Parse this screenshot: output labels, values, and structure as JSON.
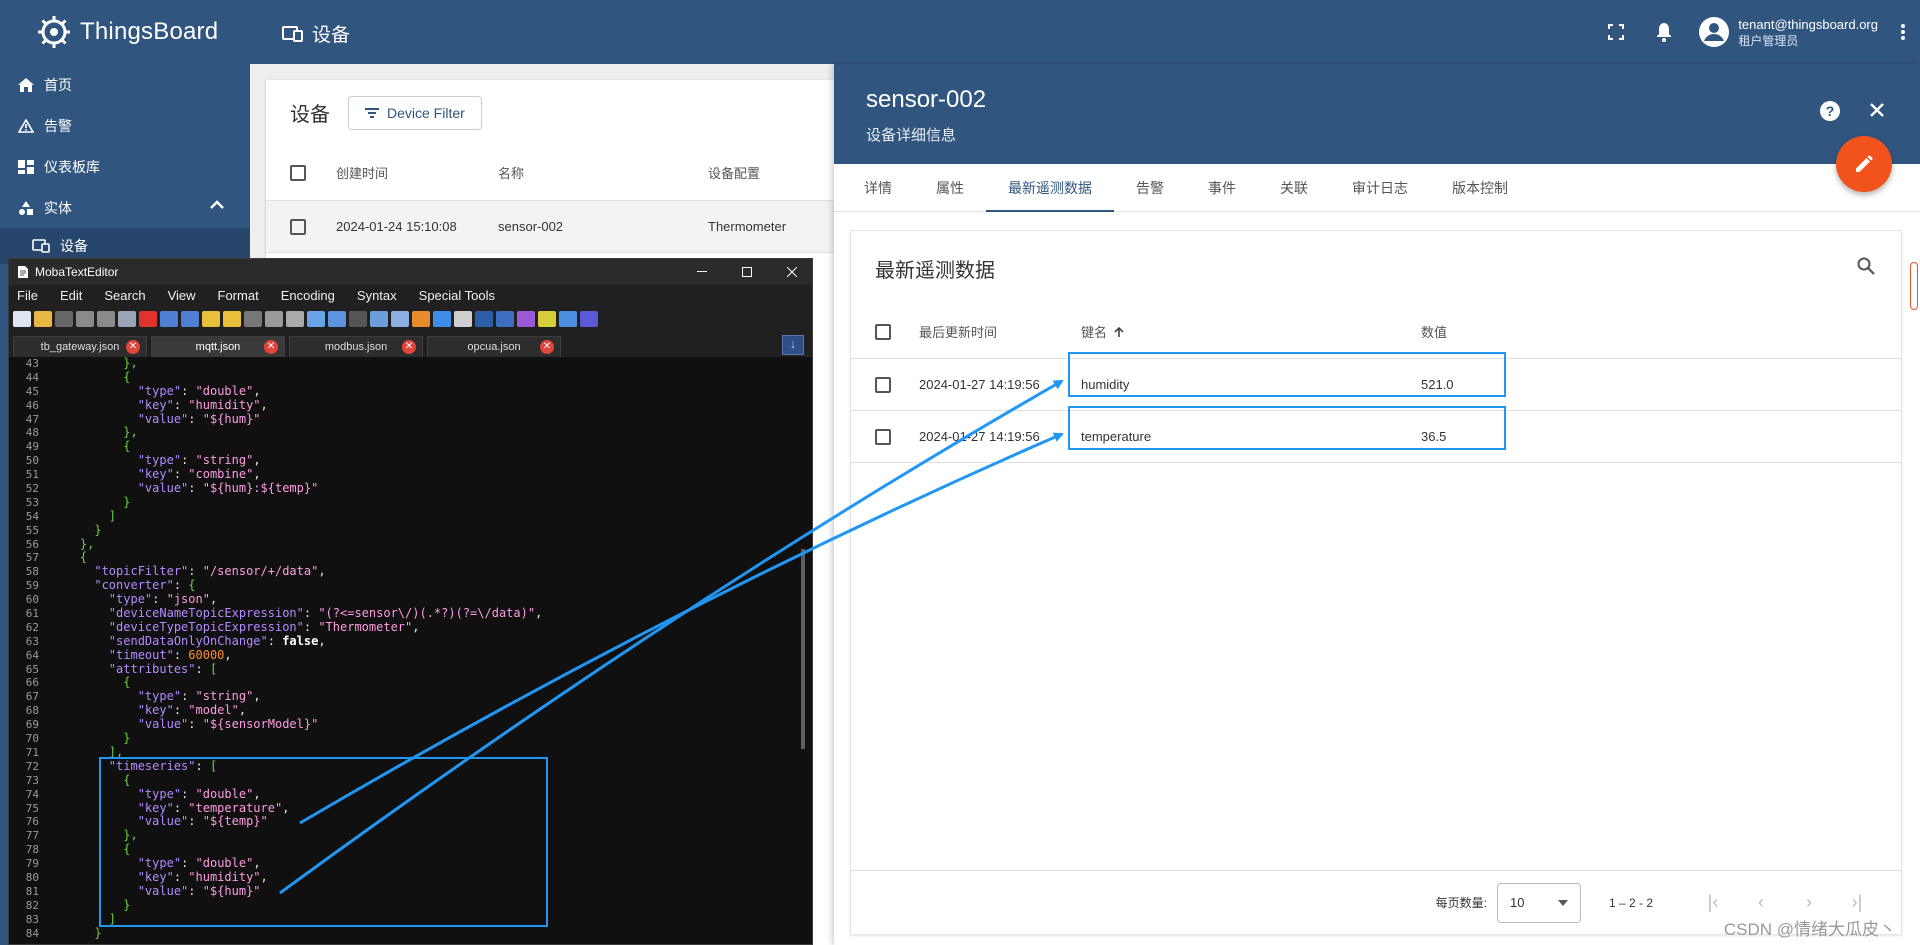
{
  "app": {
    "name": "ThingsBoard",
    "page_title": "设备"
  },
  "user": {
    "email": "tenant@thingsboard.org",
    "role": "租户管理员"
  },
  "sidebar": {
    "items": [
      {
        "label": "首页",
        "icon": "home-icon"
      },
      {
        "label": "告警",
        "icon": "warning-icon"
      },
      {
        "label": "仪表板库",
        "icon": "dashboard-icon"
      },
      {
        "label": "实体",
        "icon": "entities-icon"
      }
    ],
    "sub_items": [
      {
        "label": "设备",
        "icon": "devices-icon"
      }
    ]
  },
  "device_list": {
    "title": "设备",
    "filter_label": "Device Filter",
    "columns": [
      "创建时间",
      "名称",
      "设备配置"
    ],
    "rows": [
      {
        "created": "2024-01-24 15:10:08",
        "name": "sensor-002",
        "profile": "Thermometer"
      }
    ]
  },
  "details": {
    "title": "sensor-002",
    "subtitle": "设备详细信息",
    "tabs": [
      "详情",
      "属性",
      "最新遥测数据",
      "告警",
      "事件",
      "关联",
      "审计日志",
      "版本控制"
    ],
    "active_tab": "最新遥测数据",
    "telemetry": {
      "title": "最新遥测数据",
      "columns": {
        "time": "最后更新时间",
        "key": "键名",
        "value": "数值"
      },
      "rows": [
        {
          "time": "2024-01-27 14:19:56",
          "key": "humidity",
          "value": "521.0"
        },
        {
          "time": "2024-01-27 14:19:56",
          "key": "temperature",
          "value": "36.5"
        }
      ],
      "page_size_label": "每页数量:",
      "page_size": "10",
      "range": "1 – 2 - 2"
    }
  },
  "editor": {
    "title": "MobaTextEditor",
    "menu": [
      "File",
      "Edit",
      "Search",
      "View",
      "Format",
      "Encoding",
      "Syntax",
      "Special Tools"
    ],
    "tabs": [
      "tb_gateway.json",
      "mqtt.json",
      "modbus.json",
      "opcua.json"
    ],
    "active_tab": "mqtt.json"
  },
  "watermark": "CSDN @情绪大瓜皮丶",
  "colors": {
    "primary": "#305680",
    "accent": "#f2521b",
    "highlight": "#2196f3",
    "editor_bg": "#101010"
  }
}
